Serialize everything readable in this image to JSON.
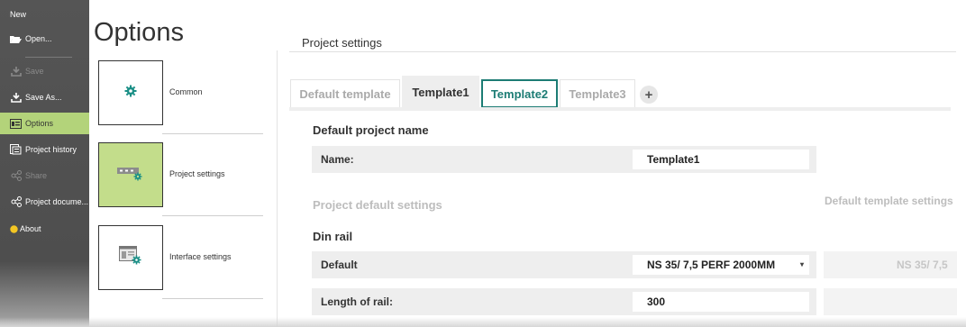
{
  "nav": {
    "items": [
      {
        "label": "New",
        "icon": "none",
        "state": "normal"
      },
      {
        "label": "Open...",
        "icon": "folder-open-icon",
        "state": "normal"
      },
      {
        "label": "Save",
        "icon": "save-icon",
        "state": "disabled"
      },
      {
        "label": "Save As...",
        "icon": "save-as-icon",
        "state": "normal"
      },
      {
        "label": "Options",
        "icon": "options-icon",
        "state": "active"
      },
      {
        "label": "Project history",
        "icon": "history-icon",
        "state": "normal"
      },
      {
        "label": "Share",
        "icon": "share-icon",
        "state": "disabled"
      },
      {
        "label": "Project docume...",
        "icon": "share-icon",
        "state": "normal"
      },
      {
        "label": "About",
        "icon": "info-dot-icon",
        "state": "normal"
      }
    ]
  },
  "options": {
    "title": "Options",
    "items": [
      {
        "label": "Common",
        "icon": "gear-icon",
        "active": false
      },
      {
        "label": "Project settings",
        "icon": "rail-gear-icon",
        "active": true
      },
      {
        "label": "Interface settings",
        "icon": "window-gear-icon",
        "active": false
      }
    ]
  },
  "panel": {
    "title": "Project settings",
    "tabs": [
      {
        "label": "Default template",
        "state": "inactive"
      },
      {
        "label": "Template1",
        "state": "current"
      },
      {
        "label": "Template2",
        "state": "focused"
      },
      {
        "label": "Template3",
        "state": "inactive"
      }
    ],
    "add_tab_label": "+",
    "default_name": {
      "heading": "Default project name",
      "label": "Name:",
      "value": "Template1"
    },
    "project_defaults": {
      "heading": "Project default settings",
      "right_heading": "Default template settings"
    },
    "din_rail": {
      "heading": "Din rail",
      "rows": [
        {
          "label": "Default",
          "value": "NS 35/ 7,5 PERF 2000MM",
          "ghost": "NS 35/ 7,5"
        },
        {
          "label": "Length of rail:",
          "value": "300",
          "ghost": ""
        }
      ]
    }
  },
  "colors": {
    "nav_bg": "#555555",
    "active_green": "#b3d37a",
    "thumb_green": "#c3dd8b",
    "teal": "#1c7c74",
    "icon_teal": "#1a8f86"
  }
}
